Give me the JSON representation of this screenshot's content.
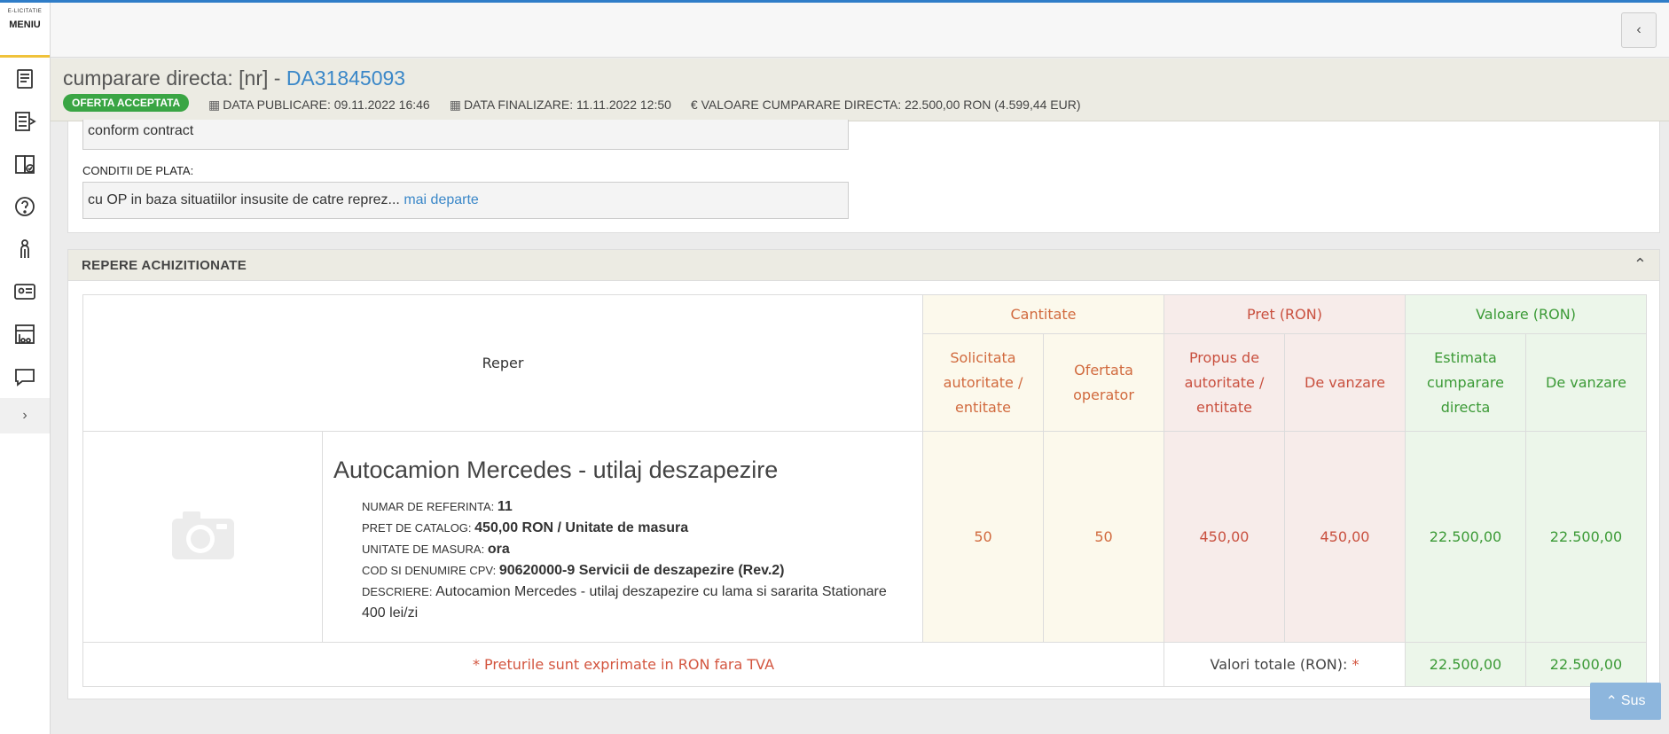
{
  "sidebar": {
    "brand": "E-LICITATIE",
    "menu_label": "MENIU",
    "icons": [
      "document-icon",
      "export-list-icon",
      "book-check-icon",
      "help-circle-icon",
      "user-hierarchy-icon",
      "id-card-icon",
      "cart-icon",
      "chat-bubble-icon"
    ],
    "expand_label": "›"
  },
  "topbar": {
    "collapse_label": "‹"
  },
  "header": {
    "title_prefix": "cumparare directa: [nr] - ",
    "code": "DA31845093",
    "status": "OFERTA ACCEPTATA",
    "publish": "DATA PUBLICARE: 09.11.2022 16:46",
    "finalize": "DATA FINALIZARE: 11.11.2022 12:50",
    "value": "€ VALOARE CUMPARARE DIRECTA: 22.500,00  RON (4.599,44  EUR)"
  },
  "details": {
    "field1_value": "conform contract",
    "payment_label": "CONDITII DE PLATA:",
    "payment_value": "cu OP in baza situatiilor insusite de catre reprez...",
    "more_link": "mai departe"
  },
  "repere": {
    "title": "REPERE ACHIZITIONATE",
    "col_reper": "Reper",
    "group_cantitate": "Cantitate",
    "group_pret": "Pret (RON)",
    "group_valoare": "Valoare (RON)",
    "sub_solicitata": "Solicitata autoritate / entitate",
    "sub_ofertata": "Ofertata operator",
    "sub_propus": "Propus de autoritate / entitate",
    "sub_vanzare_pret": "De vanzare",
    "sub_estimata": "Estimata cumparare directa",
    "sub_vanzare_val": "De vanzare",
    "item": {
      "name": "Autocamion Mercedes - utilaj deszapezire",
      "ref_label": "NUMAR DE REFERINTA:",
      "ref_value": "11",
      "catalog_label": "PRET DE CATALOG:",
      "catalog_value": "450,00  RON / Unitate de masura",
      "unit_label": "UNITATE DE MASURA:",
      "unit_value": "ora",
      "cpv_label": "COD SI DENUMIRE CPV:",
      "cpv_value": "90620000-9 Servicii de deszapezire (Rev.2)",
      "desc_label": "DESCRIERE:",
      "desc_value": "Autocamion Mercedes - utilaj deszapezire cu lama si sararita Stationare 400 lei/zi",
      "solicitata": "50",
      "ofertata": "50",
      "pret_propus": "450,00",
      "pret_vanzare": "450,00",
      "val_estimata": "22.500,00",
      "val_vanzare": "22.500,00"
    },
    "footer_note": "* Preturile sunt exprimate in RON fara TVA",
    "totals_label": "Valori totale (RON):",
    "totals_star": "*",
    "total_estimata": "22.500,00",
    "total_vanzare": "22.500,00"
  },
  "scroll_top": "Sus"
}
